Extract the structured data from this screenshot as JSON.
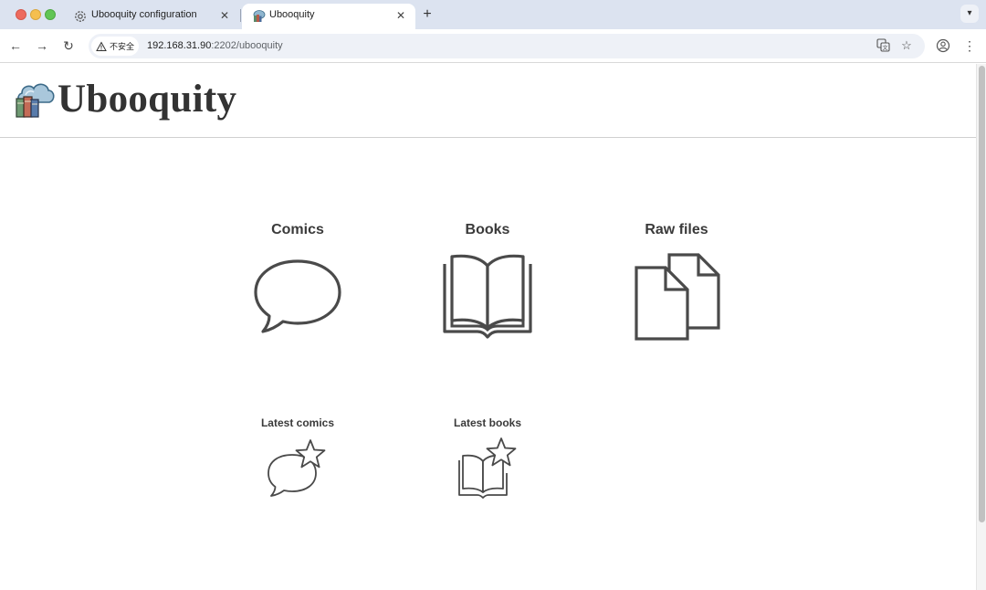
{
  "browser": {
    "tabs": [
      {
        "title": "Ubooquity configuration",
        "icon": "gear-icon"
      },
      {
        "title": "Ubooquity",
        "icon": "ubooquity-favicon",
        "active": true
      }
    ],
    "new_tab_label": "+",
    "security_label": "不安全",
    "url": {
      "host": "192.168.31.90",
      "rest": ":2202/ubooquity"
    }
  },
  "site": {
    "title": "Ubooquity"
  },
  "tiles": {
    "comics": {
      "label": "Comics",
      "icon": "speech-bubble-icon"
    },
    "books": {
      "label": "Books",
      "icon": "open-book-icon"
    },
    "raw_files": {
      "label": "Raw files",
      "icon": "documents-icon"
    },
    "latest_comics": {
      "label": "Latest comics",
      "icon": "speech-bubble-star-icon"
    },
    "latest_books": {
      "label": "Latest books",
      "icon": "open-book-star-icon"
    }
  },
  "colors": {
    "icon_stroke": "#4a4a4a",
    "tabstrip": "#dce3f0"
  }
}
